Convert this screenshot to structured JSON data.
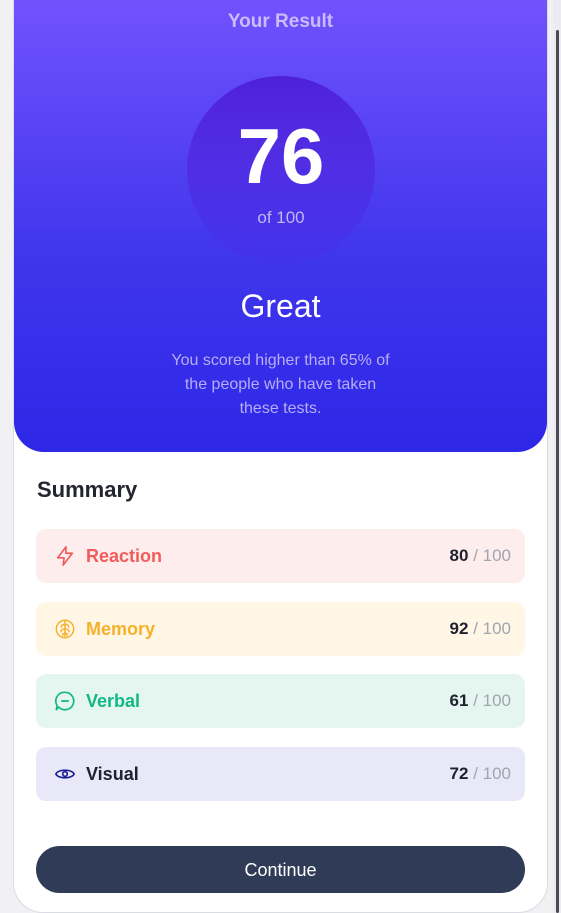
{
  "hero": {
    "title": "Your Result",
    "score": "76",
    "score_max": "of 100",
    "rating": "Great",
    "description": "You scored higher than 65% of the people who have taken these tests."
  },
  "summary": {
    "title": "Summary",
    "items": [
      {
        "label": "Reaction",
        "score": "80",
        "max": "/ 100",
        "icon": "lightning-icon",
        "color": "#f25b5b",
        "bg": "#fdeded"
      },
      {
        "label": "Memory",
        "score": "92",
        "max": "/ 100",
        "icon": "brain-icon",
        "color": "#f5b12a",
        "bg": "#fff6e5"
      },
      {
        "label": "Verbal",
        "score": "61",
        "max": "/ 100",
        "icon": "chat-bubble-icon",
        "color": "#11b884",
        "bg": "#e5f6f1"
      },
      {
        "label": "Visual",
        "score": "72",
        "max": "/ 100",
        "icon": "eye-icon",
        "color": "#1b1f8f",
        "bg": "#e8e8f9"
      }
    ]
  },
  "actions": {
    "continue_label": "Continue"
  },
  "colors": {
    "hero_top": "#7755ff",
    "hero_bottom": "#2d27e6",
    "button": "#303b57"
  }
}
